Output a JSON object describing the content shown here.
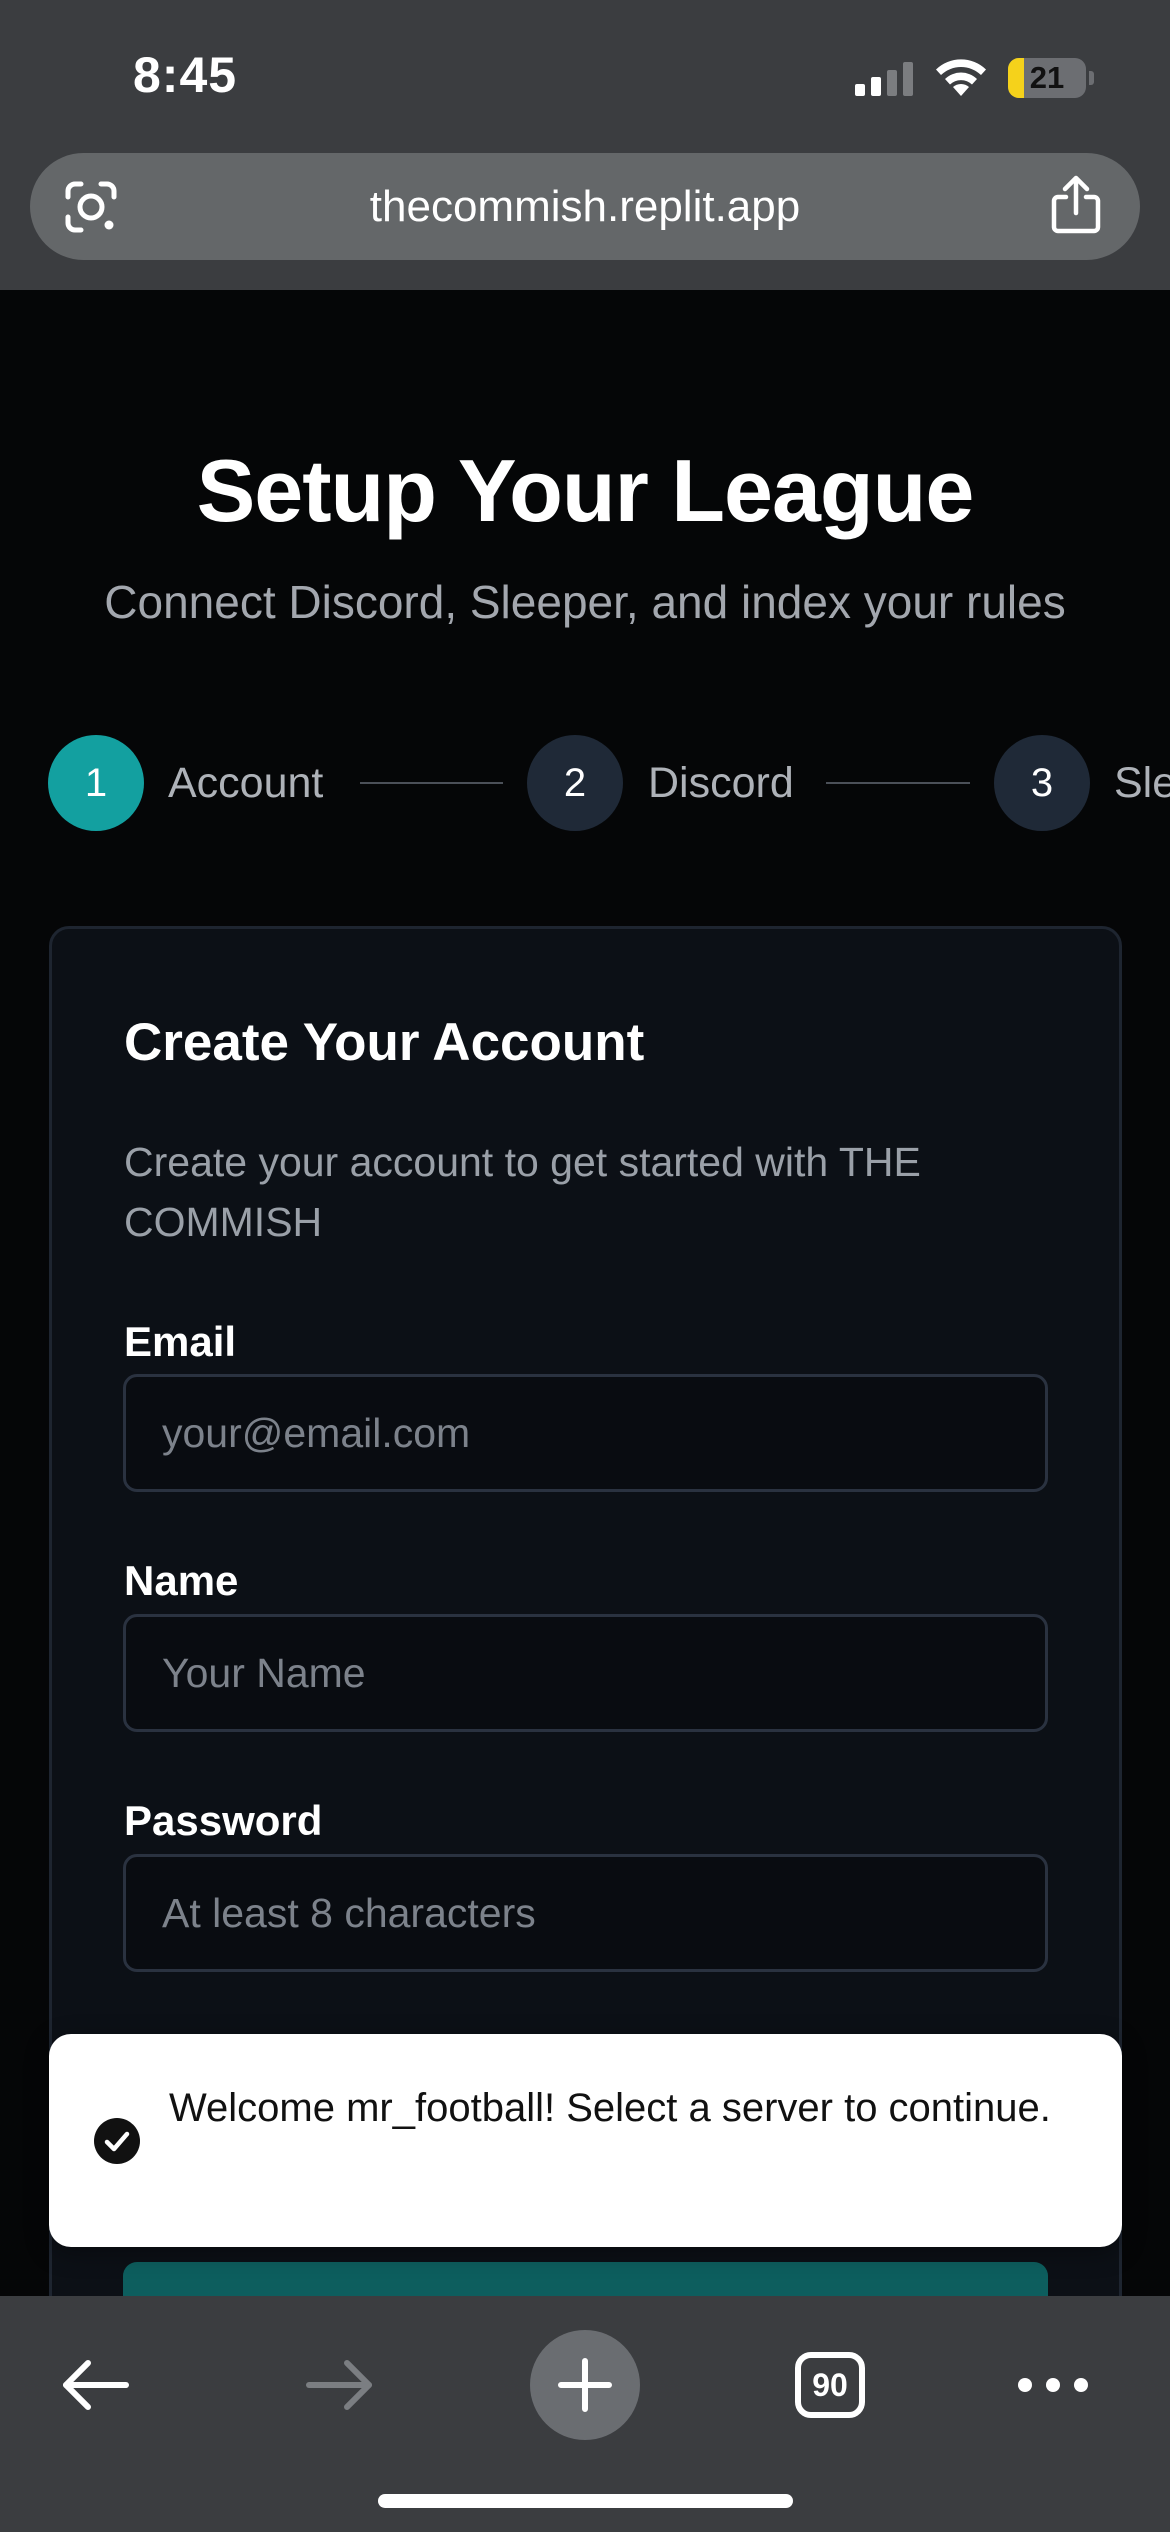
{
  "status_bar": {
    "time": "8:45",
    "battery_level": "21",
    "battery_fraction": 0.21,
    "signal_bars_active": 2,
    "signal_bars_total": 4
  },
  "browser": {
    "url": "thecommish.replit.app",
    "open_tabs": "90",
    "icons": {
      "lens": "google-lens-icon",
      "share": "share-icon",
      "back": "back-arrow-icon",
      "forward": "forward-arrow-icon",
      "new_tab": "plus-icon",
      "more": "more-dots-icon"
    }
  },
  "page": {
    "title": "Setup Your League",
    "subtitle": "Connect Discord, Sleeper, and index your rules",
    "steps": [
      {
        "number": "1",
        "label": "Account",
        "active": true
      },
      {
        "number": "2",
        "label": "Discord",
        "active": false
      },
      {
        "number": "3",
        "label": "Sle",
        "active": false
      }
    ],
    "card": {
      "title": "Create Your Account",
      "description": "Create your account to get started with THE COMMISH",
      "fields": [
        {
          "label": "Email",
          "placeholder": "your@email.com",
          "value": ""
        },
        {
          "label": "Name",
          "placeholder": "Your Name",
          "value": ""
        },
        {
          "label": "Password",
          "placeholder": "At least 8 characters",
          "value": ""
        }
      ]
    }
  },
  "toast": {
    "message": "Welcome mr_football! Select a server to continue.",
    "icon": "check-circle-icon"
  },
  "colors": {
    "accent_teal": "#13a0a0",
    "button_teal": "#0d5e5e",
    "background": "#050607",
    "card": "#0c1016",
    "chrome": "#3b3d40"
  }
}
